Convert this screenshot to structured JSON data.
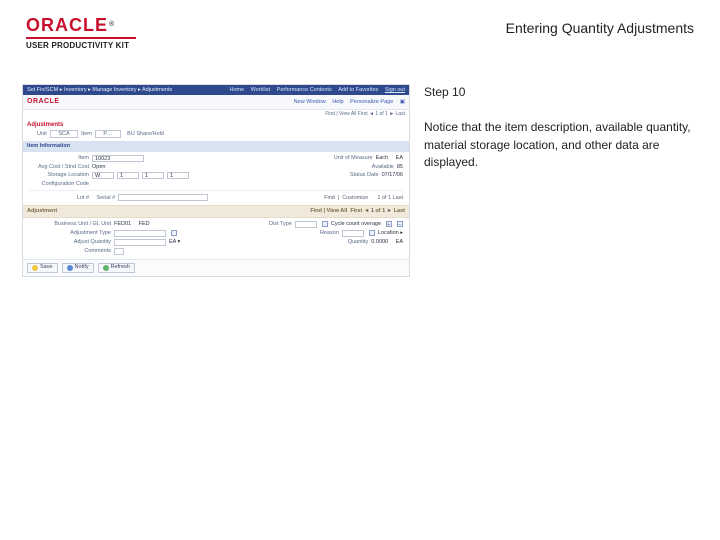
{
  "header": {
    "brand": "ORACLE",
    "subbrand": "USER PRODUCTIVITY KIT",
    "title": "Entering Quantity Adjustments"
  },
  "instruction": {
    "step_label": "Step 10",
    "text": "Notice that the item description, available quantity, material storage location, and other data are displayed."
  },
  "shot": {
    "topbar": {
      "breadcrumb": "Set Fin/SCM ▸ Inventory ▸ Manage Inventory ▸ Adjustments",
      "tabs": [
        "Home",
        "Worklist",
        "Performance Contents",
        "Add to Favorites"
      ],
      "signout": "Sign out"
    },
    "brandbar": {
      "logo": "ORACLE",
      "links": [
        "New Window",
        "Help",
        "Personalize Page",
        "▣"
      ]
    },
    "section_title": "Adjustments",
    "org": {
      "unit_label": "Unit",
      "unit": "SCA",
      "item_label": "Item",
      "item": "P…",
      "find": "Find",
      "bu": "BU",
      "bu_val": "Share/Hold"
    },
    "item_info": {
      "band": "Item Information",
      "rows": [
        {
          "l1": "Item",
          "v1": "10023",
          "l2": "Unit of Measure",
          "v2": "Each",
          "v2b": "EA"
        },
        {
          "l1": "Avg Cost / Stnd Cost",
          "v1": "Open",
          "l2": "Available",
          "v2": "85"
        },
        {
          "l1": "Storage Location",
          "v1": "W",
          "v1b": "1",
          "v1c": "1",
          "v1d": "1",
          "l2": "Status Date",
          "v2": "07/17/06"
        },
        {
          "l1": "Configuration Code",
          "v1": ""
        }
      ],
      "lot": {
        "lot_label": "Lot #",
        "serial_label": "Serial #",
        "lot_val": "",
        "find_label": "Find",
        "customize_label": "Customize",
        "nav": "1 of 1  Last"
      }
    },
    "adjustment": {
      "band": "Adjustment",
      "find_label": "Find | View All",
      "nav": "First ◄ 1 of 1 ► Last",
      "rows": [
        {
          "l1": "Business Unit / GL Unit",
          "v1": "FED01",
          "v1b": "FED",
          "l2": "Dist Type",
          "v2": "",
          "i2": "Cycle count overage",
          "plus": "+",
          "minus": "−"
        },
        {
          "l1": "Adjustment Type",
          "v1": "",
          "l2": "Reason",
          "v2": "",
          "i2": "Location ▸"
        },
        {
          "l1": "Adjust Quantity",
          "v1": "",
          "u1": "EA  ▾",
          "l2": "Quantity",
          "v2": "0.0000",
          "u2": "EA"
        },
        {
          "l1": "Comments",
          "v1": ""
        }
      ]
    },
    "footer": {
      "save": "Save",
      "notify": "Notify",
      "refresh": "Refresh"
    }
  }
}
